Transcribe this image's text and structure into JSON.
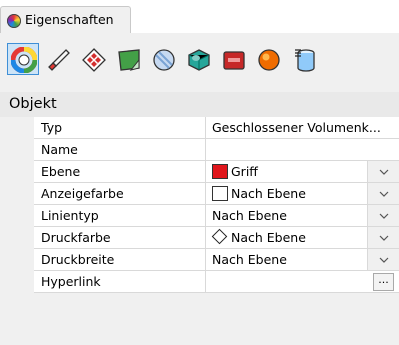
{
  "window": {
    "tab_label": "Eigenschaften",
    "tab_icon": "color-wheel-icon"
  },
  "toolbar": {
    "buttons": [
      {
        "icon": "object-properties-icon",
        "active": true
      },
      {
        "icon": "material-brush-icon"
      },
      {
        "icon": "texture-mapping-icon"
      },
      {
        "icon": "decal-icon"
      },
      {
        "icon": "displacement-icon"
      },
      {
        "icon": "shadow-icon"
      },
      {
        "icon": "render-mesh-icon"
      },
      {
        "icon": "curve-piping-icon"
      },
      {
        "icon": "layer-stack-icon"
      }
    ]
  },
  "section": {
    "title": "Objekt"
  },
  "properties": {
    "rows": [
      {
        "name": "Typ",
        "value": "Geschlossener Volumenk..."
      },
      {
        "name": "Name",
        "value": ""
      },
      {
        "name": "Ebene",
        "value": "Griff",
        "swatch_color": "#e0161c"
      },
      {
        "name": "Anzeigefarbe",
        "value": "Nach Ebene",
        "swatch_color": "#ffffff"
      },
      {
        "name": "Linientyp",
        "value": "Nach Ebene"
      },
      {
        "name": "Druckfarbe",
        "value": "Nach Ebene",
        "icon": "diamond-icon"
      },
      {
        "name": "Druckbreite",
        "value": "Nach Ebene"
      },
      {
        "name": "Hyperlink",
        "value": "",
        "button_label": "..."
      }
    ]
  },
  "colors": {
    "accent": "#3f8fd6",
    "layer_red": "#e0161c"
  }
}
